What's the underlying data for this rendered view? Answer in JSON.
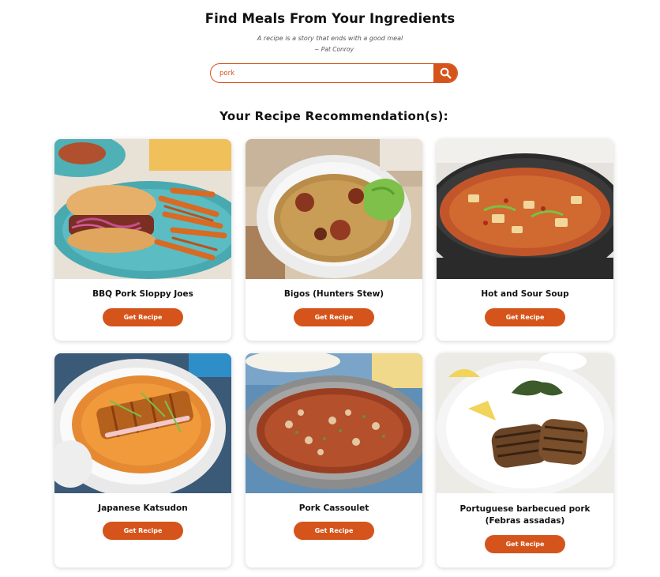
{
  "header": {
    "title": "Find Meals From Your Ingredients",
    "quote": "A recipe is a story that ends with a good meal",
    "author": "~ Pat Conroy"
  },
  "search": {
    "value": "pork",
    "icon": "search-icon"
  },
  "results": {
    "heading": "Your Recipe Recommendation(s):",
    "button_label": "Get Recipe",
    "recipes": [
      {
        "name": "BBQ Pork Sloppy Joes"
      },
      {
        "name": "Bigos (Hunters Stew)"
      },
      {
        "name": "Hot and Sour Soup"
      },
      {
        "name": "Japanese Katsudon"
      },
      {
        "name": "Pork Cassoulet"
      },
      {
        "name": "Portuguese barbecued pork (Febras assadas)"
      }
    ]
  },
  "colors": {
    "accent": "#d5541b"
  }
}
